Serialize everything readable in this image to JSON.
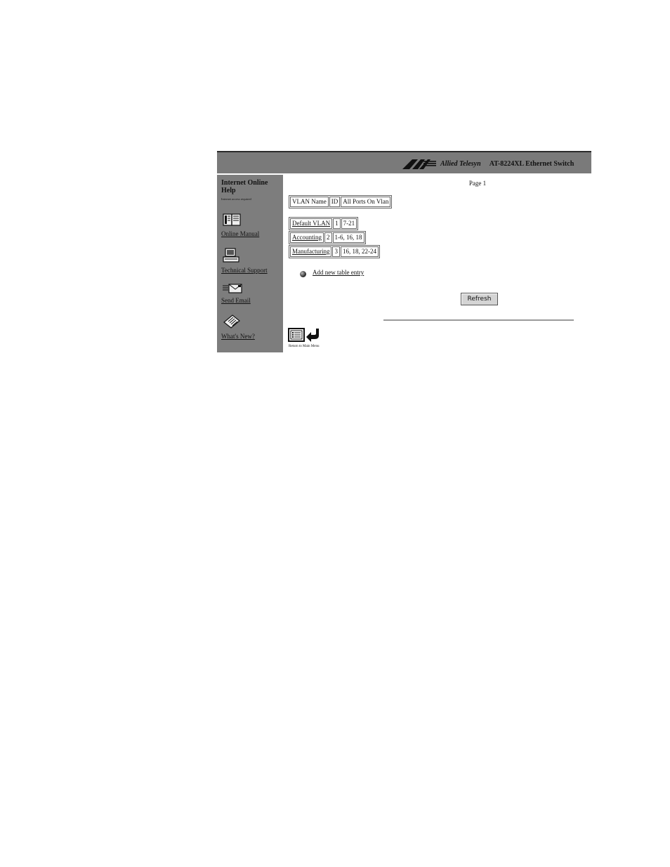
{
  "header": {
    "brand_name": "Allied Telesyn",
    "product_name": "AT-8224XL Ethernet Switch",
    "logo_icon": "allied-telesyn-logo"
  },
  "sidebar": {
    "title": "Internet Online Help",
    "subtitle": "Internet access required",
    "items": [
      {
        "label": "Online Manual",
        "icon": "book-icon"
      },
      {
        "label": "Technical Support",
        "icon": "computer-icon"
      },
      {
        "label": "Send Email",
        "icon": "envelope-icon"
      },
      {
        "label": "What's New?",
        "icon": "newspaper-icon"
      }
    ]
  },
  "main": {
    "page_label": "Page 1",
    "table_header": [
      "VLAN Name",
      "ID",
      "All Ports On Vlan"
    ],
    "rows": [
      {
        "name": "Default VLAN",
        "id": "1",
        "ports": "7-21"
      },
      {
        "name": "Accounting",
        "id": "2",
        "ports": "1-6, 16, 18"
      },
      {
        "name": "Manufacturing",
        "id": "3",
        "ports": "16, 18, 22-24"
      }
    ],
    "add_entry_label": "Add new table entry",
    "refresh_label": "Refresh",
    "return_label": "Return to Main Menu"
  },
  "colors": {
    "sidebar_bg": "#7d7d7d",
    "header_bg": "#7a7a7a",
    "page_bg": "#ffffff"
  }
}
